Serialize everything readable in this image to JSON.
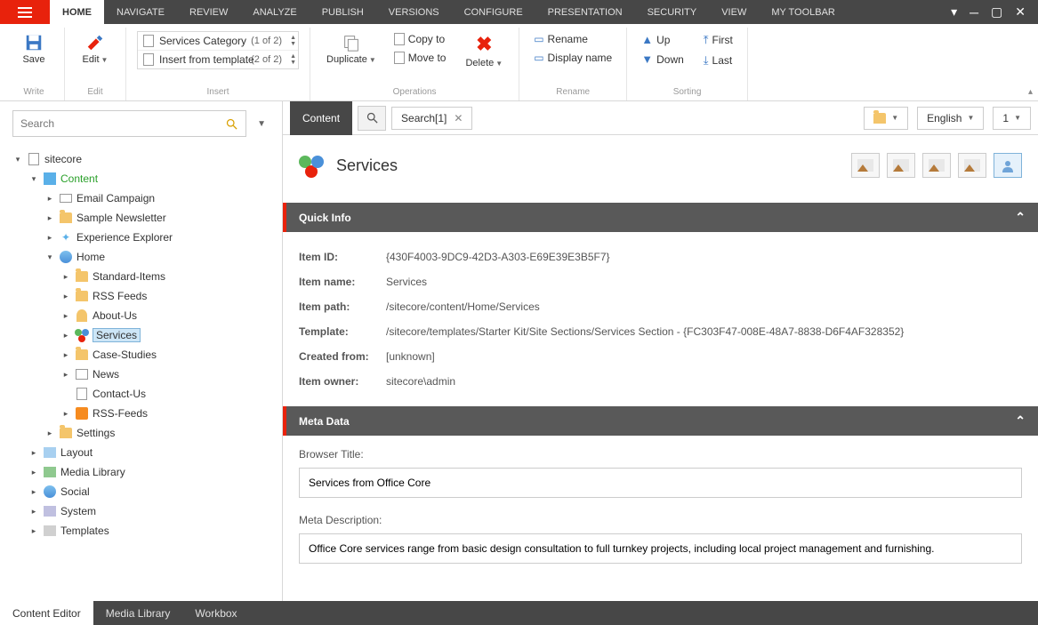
{
  "tabs": [
    "HOME",
    "NAVIGATE",
    "REVIEW",
    "ANALYZE",
    "PUBLISH",
    "VERSIONS",
    "CONFIGURE",
    "PRESENTATION",
    "SECURITY",
    "VIEW",
    "MY TOOLBAR"
  ],
  "ribbon": {
    "save": {
      "label": "Save",
      "sub": "Write"
    },
    "edit": {
      "label": "Edit",
      "sub": "Edit"
    },
    "insert": {
      "label": "Insert",
      "rows": [
        {
          "name": "Services Category",
          "count": "(1 of 2)"
        },
        {
          "name": "Insert from template",
          "count": "(2 of 2)"
        }
      ]
    },
    "ops": {
      "label": "Operations",
      "dup": "Duplicate",
      "copy": "Copy to",
      "move": "Move to",
      "del": "Delete"
    },
    "rename": {
      "label": "Rename",
      "ren": "Rename",
      "disp": "Display name"
    },
    "sort": {
      "label": "Sorting",
      "up": "Up",
      "down": "Down",
      "first": "First",
      "last": "Last"
    }
  },
  "search": {
    "placeholder": "Search"
  },
  "tree": [
    {
      "d": 0,
      "t": "▾",
      "i": "page",
      "l": "sitecore"
    },
    {
      "d": 1,
      "t": "▾",
      "i": "cube",
      "l": "Content",
      "bold": true
    },
    {
      "d": 2,
      "t": "▸",
      "i": "mail",
      "l": "Email Campaign"
    },
    {
      "d": 2,
      "t": "▸",
      "i": "folder",
      "l": "Sample Newsletter"
    },
    {
      "d": 2,
      "t": "▸",
      "i": "sparkle",
      "l": "Experience Explorer"
    },
    {
      "d": 2,
      "t": "▾",
      "i": "globe",
      "l": "Home"
    },
    {
      "d": 3,
      "t": "▸",
      "i": "folder",
      "l": "Standard-Items"
    },
    {
      "d": 3,
      "t": "▸",
      "i": "folder",
      "l": "RSS Feeds"
    },
    {
      "d": 3,
      "t": "▸",
      "i": "user",
      "l": "About-Us"
    },
    {
      "d": 3,
      "t": "▸",
      "i": "circles",
      "l": "Services",
      "sel": true
    },
    {
      "d": 3,
      "t": "▸",
      "i": "folder",
      "l": "Case-Studies"
    },
    {
      "d": 3,
      "t": "▸",
      "i": "news",
      "l": "News"
    },
    {
      "d": 3,
      "t": "",
      "i": "contact",
      "l": "Contact-Us"
    },
    {
      "d": 3,
      "t": "▸",
      "i": "rss",
      "l": "RSS-Feeds"
    },
    {
      "d": 2,
      "t": "▸",
      "i": "folder",
      "l": "Settings"
    },
    {
      "d": 1,
      "t": "▸",
      "i": "layout",
      "l": "Layout"
    },
    {
      "d": 1,
      "t": "▸",
      "i": "media",
      "l": "Media Library"
    },
    {
      "d": 1,
      "t": "▸",
      "i": "globe",
      "l": "Social"
    },
    {
      "d": 1,
      "t": "▸",
      "i": "sys",
      "l": "System"
    },
    {
      "d": 1,
      "t": "▸",
      "i": "tmpl",
      "l": "Templates"
    }
  ],
  "contentTabs": {
    "content": "Content",
    "search": "Search[1]"
  },
  "topRight": {
    "lang": "English",
    "ver": "1"
  },
  "page": {
    "title": "Services",
    "sections": {
      "quick": "Quick Info",
      "meta": "Meta Data"
    },
    "info": [
      {
        "k": "Item ID:",
        "v": "{430F4003-9DC9-42D3-A303-E69E39E3B5F7}"
      },
      {
        "k": "Item name:",
        "v": "Services"
      },
      {
        "k": "Item path:",
        "v": "/sitecore/content/Home/Services"
      },
      {
        "k": "Template:",
        "v": "/sitecore/templates/Starter Kit/Site Sections/Services Section - {FC303F47-008E-48A7-8838-D6F4AF328352}"
      },
      {
        "k": "Created from:",
        "v": "[unknown]"
      },
      {
        "k": "Item owner:",
        "v": "sitecore\\admin"
      }
    ],
    "meta": {
      "titleLabel": "Browser Title:",
      "titleVal": "Services from Office Core",
      "descLabel": "Meta Description:",
      "descVal": "Office Core services range from basic design consultation to full turnkey projects, including local project management and furnishing."
    }
  },
  "bottom": [
    "Content Editor",
    "Media Library",
    "Workbox"
  ]
}
